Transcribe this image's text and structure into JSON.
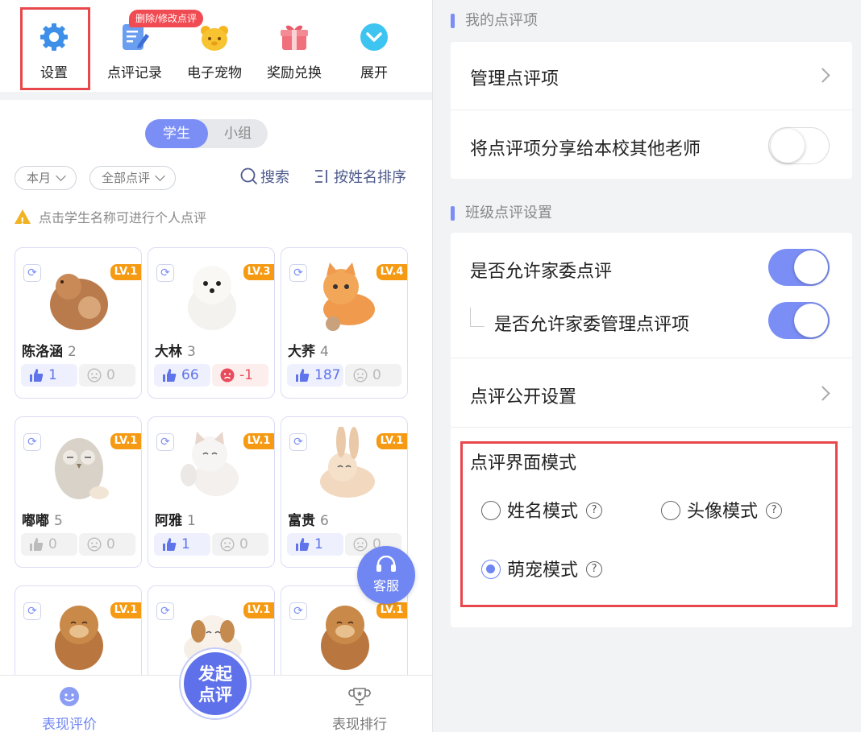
{
  "toolbar": {
    "items": [
      {
        "label": "设置",
        "icon": "gear-icon"
      },
      {
        "label": "点评记录",
        "icon": "edit-note-icon"
      },
      {
        "label": "电子宠物",
        "icon": "bear-pet-icon"
      },
      {
        "label": "奖励兑换",
        "icon": "gift-icon"
      },
      {
        "label": "展开",
        "icon": "chevron-down-icon"
      }
    ],
    "bubble": "删除/修改点评"
  },
  "segment": {
    "active": "学生",
    "inactive": "小组"
  },
  "filters": {
    "month": "本月",
    "comment_type": "全部点评"
  },
  "actions": {
    "search": "搜索",
    "sort": "按姓名排序"
  },
  "notice": "点击学生名称可进行个人点评",
  "students": [
    {
      "name": "陈洛涵",
      "num": "2",
      "level": "LV.1",
      "good": "1",
      "bad": "0",
      "pet": "poodle"
    },
    {
      "name": "大林",
      "num": "3",
      "level": "LV.3",
      "good": "66",
      "bad": "-1",
      "pet": "pomeranian"
    },
    {
      "name": "大荞",
      "num": "4",
      "level": "LV.4",
      "good": "187",
      "bad": "0",
      "pet": "cat"
    },
    {
      "name": "嘟嘟",
      "num": "5",
      "level": "LV.1",
      "good": "0",
      "bad": "0",
      "pet": "owl"
    },
    {
      "name": "阿雅",
      "num": "1",
      "level": "LV.1",
      "good": "1",
      "bad": "0",
      "pet": "kitten"
    },
    {
      "name": "富贵",
      "num": "6",
      "level": "LV.1",
      "good": "1",
      "bad": "0",
      "pet": "rabbit"
    },
    {
      "level": "LV.1",
      "pet": "otter"
    },
    {
      "level": "LV.1",
      "pet": "puppy"
    },
    {
      "level": "LV.1",
      "pet": "otter"
    }
  ],
  "kefu": "客服",
  "fab": {
    "line1": "发起",
    "line2": "点评"
  },
  "bottom_nav": {
    "left": "表现评价",
    "right": "表现排行"
  },
  "settings": {
    "section1_title": "我的点评项",
    "manage_items": "管理点评项",
    "share_items": "将点评项分享给本校其他老师",
    "share_on": false,
    "section2_title": "班级点评设置",
    "allow_parent_comment": "是否允许家委点评",
    "allow_parent_comment_on": true,
    "allow_parent_manage": "是否允许家委管理点评项",
    "allow_parent_manage_on": true,
    "public_settings": "点评公开设置",
    "mode_title": "点评界面模式",
    "modes": [
      {
        "label": "姓名模式",
        "selected": false
      },
      {
        "label": "头像模式",
        "selected": false
      },
      {
        "label": "萌宠模式",
        "selected": true
      }
    ]
  },
  "colors": {
    "accent": "#7b8ef5",
    "highlight": "#e8474c",
    "level_badge": "#f59a12"
  }
}
